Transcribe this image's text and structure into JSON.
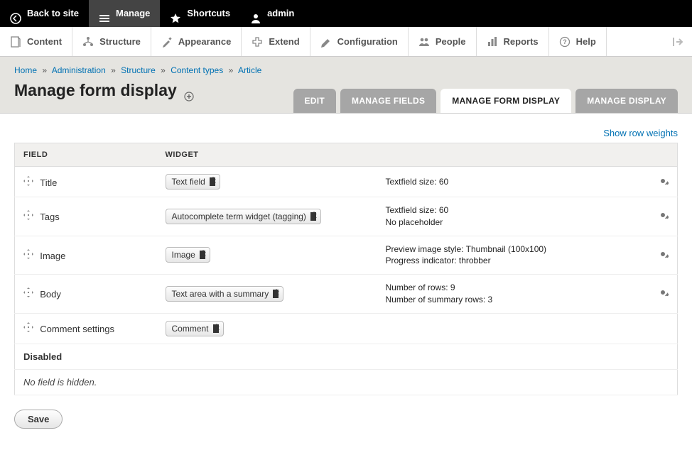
{
  "toolbar_top": {
    "back": "Back to site",
    "manage": "Manage",
    "shortcuts": "Shortcuts",
    "user": "admin"
  },
  "admin_menu": {
    "content": "Content",
    "structure": "Structure",
    "appearance": "Appearance",
    "extend": "Extend",
    "configuration": "Configuration",
    "people": "People",
    "reports": "Reports",
    "help": "Help"
  },
  "breadcrumb": {
    "items": [
      "Home",
      "Administration",
      "Structure",
      "Content types",
      "Article"
    ],
    "sep": "»"
  },
  "page_title": "Manage form display",
  "tabs": {
    "edit": "EDIT",
    "manage_fields": "MANAGE FIELDS",
    "manage_form_display": "MANAGE FORM DISPLAY",
    "manage_display": "MANAGE DISPLAY"
  },
  "show_weights": "Show row weights",
  "table": {
    "headers": {
      "field": "FIELD",
      "widget": "WIDGET"
    },
    "rows": [
      {
        "field": "Title",
        "widget": "Text field",
        "summary": "Textfield size: 60",
        "has_gear": true
      },
      {
        "field": "Tags",
        "widget": "Autocomplete term widget (tagging)",
        "summary": "Textfield size: 60\nNo placeholder",
        "has_gear": true
      },
      {
        "field": "Image",
        "widget": "Image",
        "summary": "Preview image style: Thumbnail (100x100)\nProgress indicator: throbber",
        "has_gear": true
      },
      {
        "field": "Body",
        "widget": "Text area with a summary",
        "summary": "Number of rows: 9\nNumber of summary rows: 3",
        "has_gear": true
      },
      {
        "field": "Comment settings",
        "widget": "Comment",
        "summary": "",
        "has_gear": false
      }
    ],
    "disabled_label": "Disabled",
    "no_hidden": "No field is hidden."
  },
  "save": "Save"
}
